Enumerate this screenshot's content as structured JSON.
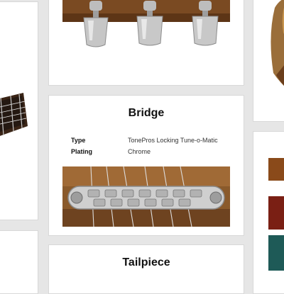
{
  "bridge_card": {
    "title": "Bridge",
    "specs": [
      {
        "label": "Type",
        "value": "TonePros Locking Tune-o-Matic"
      },
      {
        "label": "Plating",
        "value": "Chrome"
      }
    ]
  },
  "tailpiece_card": {
    "title": "Tailpiece"
  },
  "colors": {
    "page_bg": "#e6e6e6",
    "card_bg": "#ffffff",
    "wood": "#8a5a2b",
    "chrome": "#c9c9c9"
  }
}
